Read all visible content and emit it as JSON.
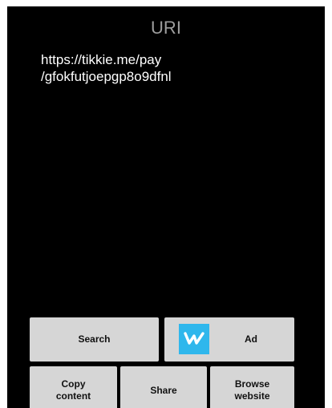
{
  "page": {
    "title": "URI",
    "uri_text": "https://tikkie.me/pay\n/gfokfutjoepgp8o9dfnl"
  },
  "actions": {
    "search_label": "Search",
    "ad_label": "Ad",
    "ad_logo_icon": "wish-logo-icon",
    "ad_logo_color": "#2fb7ec",
    "copy_label": "Copy\ncontent",
    "share_label": "Share",
    "browse_label": "Browse\nwebsite"
  }
}
